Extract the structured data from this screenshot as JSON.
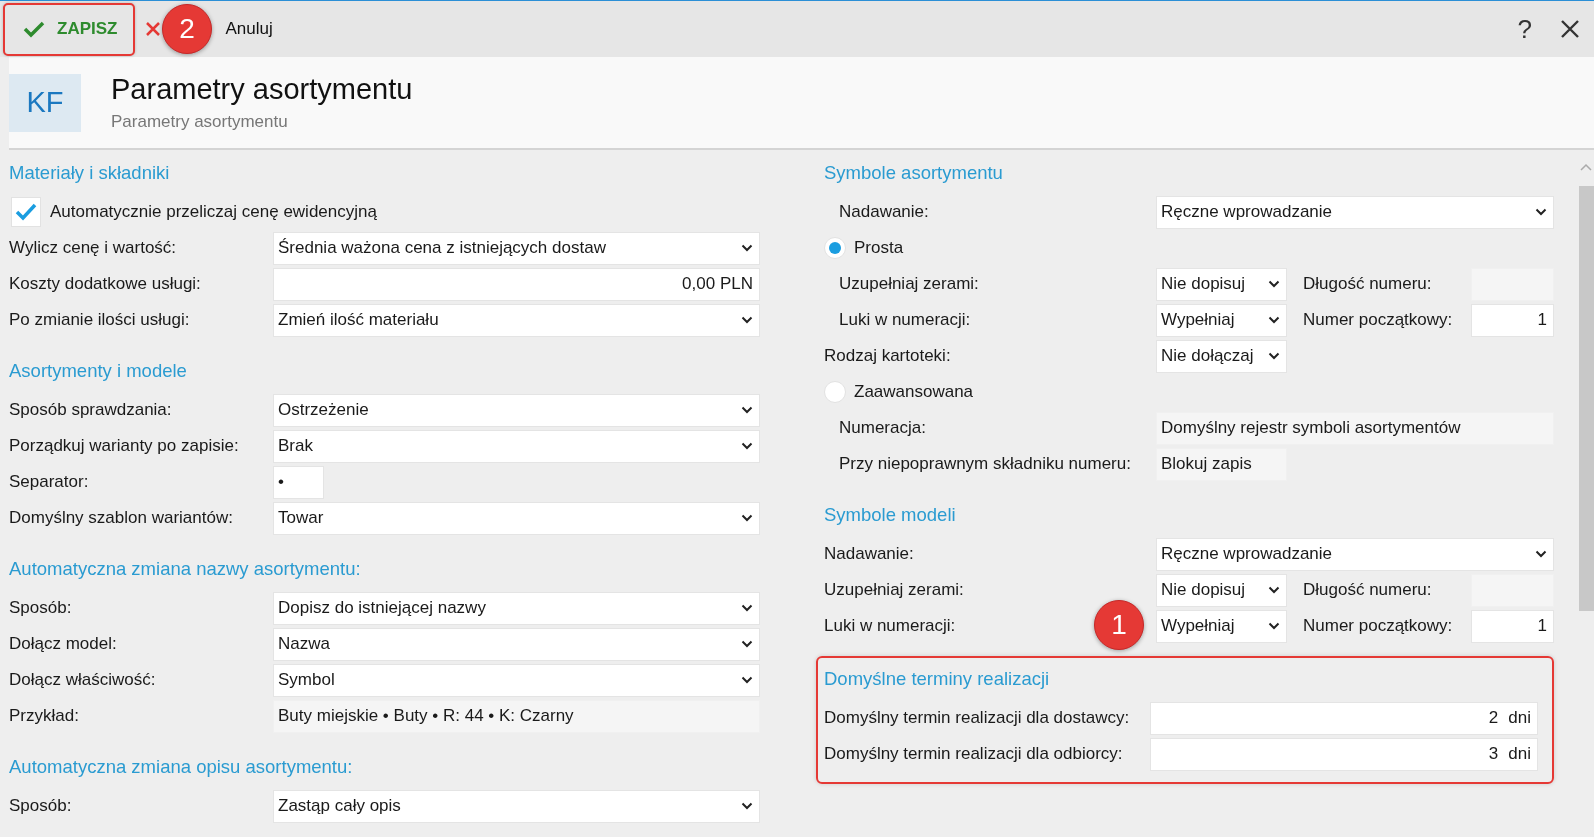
{
  "toolbar": {
    "save": {
      "label": "ZAPISZ",
      "highlighted": true
    },
    "cancel": {
      "label": "Anuluj"
    },
    "callout": "2",
    "help": "?"
  },
  "header": {
    "badge": "KF",
    "title": "Parametry asortymentu",
    "subtitle": "Parametry asortymentu"
  },
  "columns": [
    {
      "sections": [
        {
          "title": "Materiały i składniki",
          "highlighted": false,
          "rows": [
            {
              "kind": "checkbox",
              "label": "Automatycznie przeliczaj cenę ewidencyjną",
              "checked": true
            },
            {
              "kind": "field",
              "label": "Wylicz cenę i wartość:",
              "indented": false,
              "control": {
                "kind": "select",
                "compact": false,
                "value": "Średnia ważona cena z istniejących dostaw"
              }
            },
            {
              "kind": "field",
              "label": "Koszty dodatkowe usługi:",
              "indented": false,
              "control": {
                "kind": "number",
                "compact": false,
                "value": "0,00 PLN"
              }
            },
            {
              "kind": "field",
              "label": "Po zmianie ilości usługi:",
              "indented": false,
              "control": {
                "kind": "select",
                "compact": false,
                "value": "Zmień ilość materiału"
              }
            }
          ]
        },
        {
          "title": "Asortymenty i modele",
          "highlighted": false,
          "rows": [
            {
              "kind": "field",
              "label": "Sposób sprawdzania:",
              "indented": false,
              "control": {
                "kind": "select",
                "compact": false,
                "value": "Ostrzeżenie"
              }
            },
            {
              "kind": "field",
              "label": "Porządkuj warianty po zapisie:",
              "indented": false,
              "control": {
                "kind": "select",
                "compact": false,
                "value": "Brak"
              }
            },
            {
              "kind": "field",
              "label": "Separator:",
              "indented": false,
              "control": {
                "kind": "text",
                "compact": true,
                "value": "•"
              }
            },
            {
              "kind": "field",
              "label": "Domyślny szablon wariantów:",
              "indented": false,
              "control": {
                "kind": "select",
                "compact": false,
                "value": "Towar"
              }
            }
          ]
        },
        {
          "title": "Automatyczna zmiana nazwy asortymentu:",
          "highlighted": false,
          "rows": [
            {
              "kind": "field",
              "label": "Sposób:",
              "indented": false,
              "control": {
                "kind": "select",
                "compact": false,
                "value": "Dopisz do istniejącej nazwy"
              }
            },
            {
              "kind": "field",
              "label": "Dołącz model:",
              "indented": false,
              "control": {
                "kind": "select",
                "compact": false,
                "value": "Nazwa"
              }
            },
            {
              "kind": "field",
              "label": "Dołącz właściwość:",
              "indented": false,
              "control": {
                "kind": "select",
                "compact": false,
                "value": "Symbol"
              }
            },
            {
              "kind": "field",
              "label": "Przykład:",
              "indented": false,
              "control": {
                "kind": "readonly",
                "compact": false,
                "value": "Buty miejskie • Buty • R: 44 • K: Czarny"
              }
            }
          ]
        },
        {
          "title": "Automatyczna zmiana opisu asortymentu:",
          "highlighted": false,
          "rows": [
            {
              "kind": "field",
              "label": "Sposób:",
              "indented": false,
              "control": {
                "kind": "select",
                "compact": false,
                "value": "Zastąp cały opis"
              }
            }
          ]
        }
      ]
    },
    {
      "sections": [
        {
          "title": "Symbole asortymentu",
          "highlighted": false,
          "rows": [
            {
              "kind": "field",
              "label": "Nadawanie:",
              "indented": true,
              "control": {
                "kind": "select",
                "compact": false,
                "value": "Ręczne wprowadzanie"
              }
            },
            {
              "kind": "radio",
              "label": "Prosta",
              "selected": true
            },
            {
              "kind": "field",
              "label": "Uzupełniaj zerami:",
              "indented": true,
              "control": {
                "kind": "select",
                "compact": true,
                "value": "Nie dopisuj"
              },
              "side": {
                "label": "Długość numeru:",
                "control": {
                  "kind": "readonly"
                }
              }
            },
            {
              "kind": "field",
              "label": "Luki w numeracji:",
              "indented": true,
              "control": {
                "kind": "select",
                "compact": true,
                "value": "Wypełniaj"
              },
              "side": {
                "label": "Numer początkowy:",
                "control": {
                  "kind": "number",
                  "value": "1"
                }
              }
            },
            {
              "kind": "field",
              "label": "Rodzaj kartoteki:",
              "indented": false,
              "control": {
                "kind": "select",
                "compact": true,
                "value": "Nie dołączaj"
              }
            },
            {
              "kind": "radio",
              "label": "Zaawansowana",
              "selected": false
            },
            {
              "kind": "field",
              "label": "Numeracja:",
              "indented": true,
              "control": {
                "kind": "readonly",
                "compact": false,
                "value": "Domyślny rejestr symboli asortymentów"
              }
            },
            {
              "kind": "field",
              "label": "Przy niepoprawnym składniku numeru:",
              "indented": true,
              "control": {
                "kind": "readonly",
                "compact": true,
                "value": "Blokuj zapis"
              }
            }
          ]
        },
        {
          "title": "Symbole modeli",
          "highlighted": false,
          "rows": [
            {
              "kind": "field",
              "label": "Nadawanie:",
              "indented": false,
              "control": {
                "kind": "select",
                "compact": false,
                "value": "Ręczne wprowadzanie"
              }
            },
            {
              "kind": "field",
              "label": "Uzupełniaj zerami:",
              "indented": false,
              "control": {
                "kind": "select",
                "compact": true,
                "value": "Nie dopisuj"
              },
              "side": {
                "label": "Długość numeru:",
                "control": {
                  "kind": "readonly"
                }
              }
            },
            {
              "kind": "field",
              "label": "Luki w numeracji:",
              "indented": false,
              "callout": "1",
              "control": {
                "kind": "select",
                "compact": true,
                "value": "Wypełniaj"
              },
              "side": {
                "label": "Numer początkowy:",
                "control": {
                  "kind": "number",
                  "value": "1"
                }
              }
            }
          ]
        },
        {
          "title": "Domyślne terminy realizacji",
          "highlighted": true,
          "rows": [
            {
              "kind": "field",
              "label": "Domyślny termin realizacji dla dostawcy:",
              "indented": false,
              "control": {
                "kind": "number",
                "compact": false,
                "value": "2",
                "unit": "dni"
              }
            },
            {
              "kind": "field",
              "label": "Domyślny termin realizacji dla odbiorcy:",
              "indented": false,
              "control": {
                "kind": "number",
                "compact": false,
                "value": "3",
                "unit": "dni"
              }
            }
          ]
        }
      ]
    }
  ]
}
